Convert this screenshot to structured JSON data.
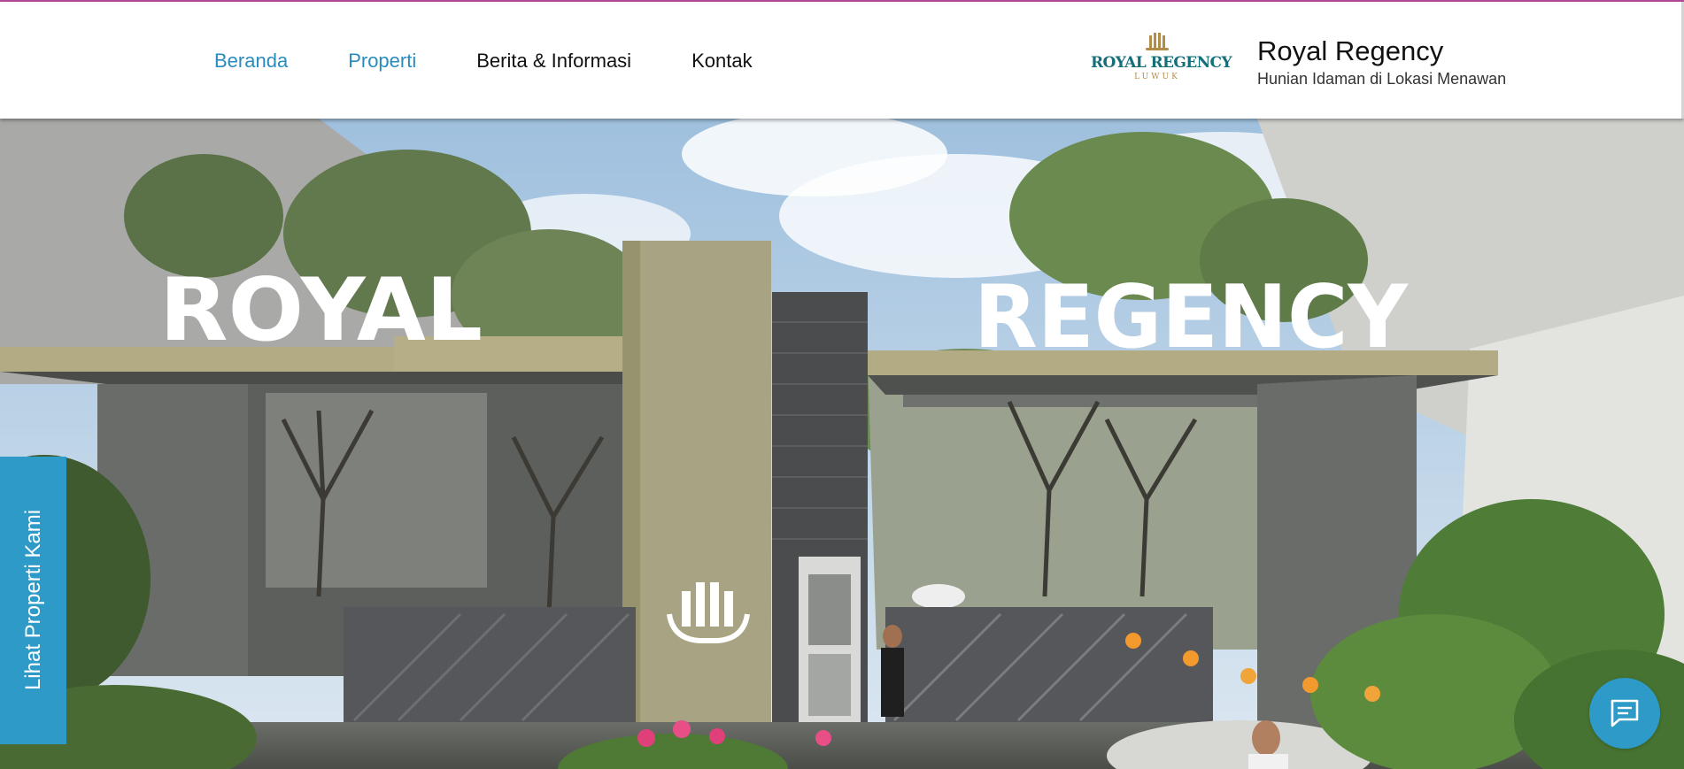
{
  "nav": {
    "items": [
      {
        "label": "Beranda",
        "active": true
      },
      {
        "label": "Properti",
        "active": true
      },
      {
        "label": "Berita & Informasi",
        "active": false
      },
      {
        "label": "Kontak",
        "active": false
      }
    ]
  },
  "logo": {
    "main": "ROYAL REGENCY",
    "sub": "LUWUK"
  },
  "site": {
    "title": "Royal Regency",
    "tagline": "Hunian Idaman di Lokasi Menawan"
  },
  "hero": {
    "sign_left": "ROYAL",
    "sign_right": "REGENCY",
    "emblem_icon": "crown-icon"
  },
  "side_tab": {
    "label": "Lihat Properti Kami"
  },
  "chat": {
    "icon": "chat-icon"
  },
  "colors": {
    "accent": "#2e9ac7",
    "nav_active": "#2a8cbe",
    "logo_teal": "#156f79",
    "logo_gold": "#b28d4a",
    "top_line": "#b5489a"
  }
}
